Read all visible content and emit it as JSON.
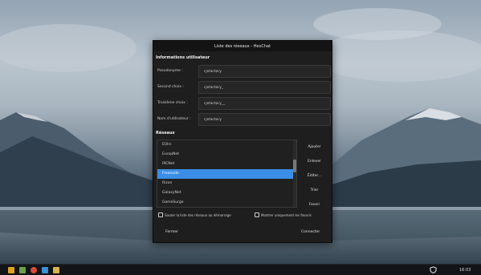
{
  "window": {
    "title": "Liste des réseaux - HexChat"
  },
  "user_info": {
    "section_title": "Informations utilisateur",
    "fields": [
      {
        "label": "Pseudonyme :",
        "value": "cjsfactory"
      },
      {
        "label": "Second choix :",
        "value": "cjsfactory_"
      },
      {
        "label": "Troisième choix :",
        "value": "cjsfactory__"
      },
      {
        "label": "Nom d'utilisateur :",
        "value": "cjsfactory"
      }
    ]
  },
  "networks": {
    "section_title": "Réseaux",
    "items": [
      "EUIrc",
      "EuropNet",
      "IRCNet",
      "Rizon",
      "Rizon",
      "GalaxyNet",
      "GameSurge"
    ],
    "selected_index": 4,
    "selected_label": "Freenode"
  },
  "side_buttons": {
    "add": "Ajouter",
    "remove": "Enlever",
    "edit": "Éditer...",
    "sort": "Trier",
    "favorite": "Favori"
  },
  "options": {
    "skip_on_startup": "Sauter la liste des réseaux au démarrage",
    "favorites_only": "Montrer uniquement les favoris"
  },
  "footer": {
    "close": "Fermer",
    "connect": "Connecter"
  },
  "taskbar": {
    "icons": [
      {
        "name": "menu-icon",
        "color": "#e0a020"
      },
      {
        "name": "files-icon",
        "color": "#6ea04a"
      },
      {
        "name": "browser-icon",
        "color": "#d94a3a"
      },
      {
        "name": "chat-icon",
        "color": "#3d8fd6"
      },
      {
        "name": "notes-icon",
        "color": "#d9b24a"
      }
    ],
    "clock": "16:03"
  },
  "colors": {
    "accent": "#3a8ee6",
    "dialog_bg": "#1e1e1e",
    "taskbar_bg": "#121417"
  }
}
